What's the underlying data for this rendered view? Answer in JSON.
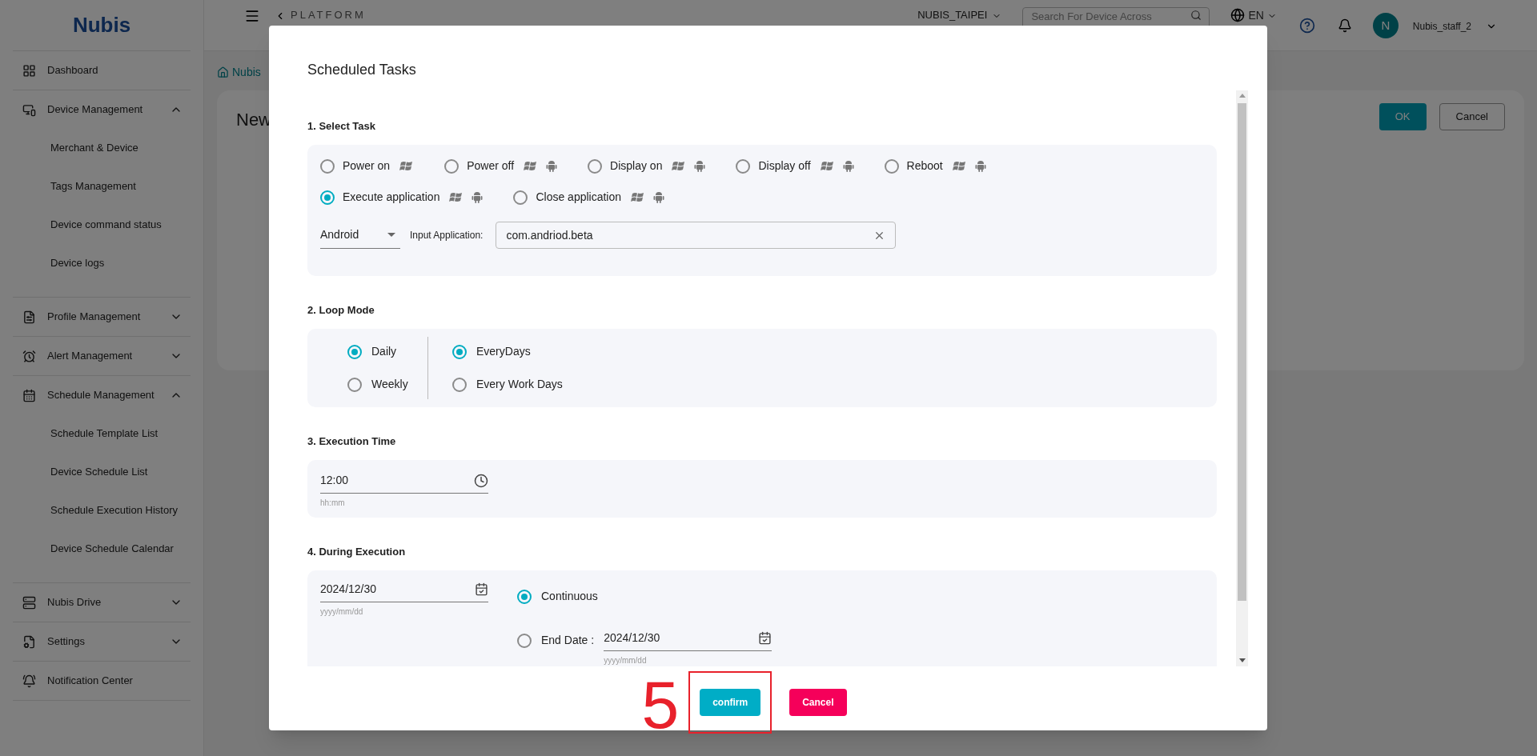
{
  "logo": "Nubis",
  "topbar": {
    "back_label": "PLATFORM",
    "store": "NUBIS_TAIPEI",
    "search": {
      "placeholder": "Search For Device Across"
    },
    "language": "EN",
    "avatar": "N",
    "user": "Nubis_staff_2"
  },
  "sidebar": {
    "items": [
      {
        "label": "Dashboard"
      },
      {
        "label": "Device Management",
        "expanded": true,
        "children": [
          {
            "label": "Merchant & Device"
          },
          {
            "label": "Tags Management"
          },
          {
            "label": "Device command status"
          },
          {
            "label": "Device logs"
          }
        ]
      },
      {
        "label": "Profile Management",
        "expanded": false
      },
      {
        "label": "Alert Management",
        "expanded": false
      },
      {
        "label": "Schedule Management",
        "expanded": true,
        "children": [
          {
            "label": "Schedule Template List"
          },
          {
            "label": "Device Schedule List"
          },
          {
            "label": "Schedule Execution History"
          },
          {
            "label": "Device Schedule Calendar"
          }
        ]
      },
      {
        "label": "Nubis Drive",
        "expanded": false
      },
      {
        "label": "Settings",
        "expanded": false
      },
      {
        "label": "Notification Center"
      }
    ]
  },
  "page": {
    "breadcrumb": "Nubis",
    "heading": "New",
    "buttons": [
      {
        "label": "OK",
        "kind": "primary"
      },
      {
        "label": "Cancel",
        "kind": "outline"
      }
    ]
  },
  "dialog": {
    "title": "Scheduled Tasks",
    "task": {
      "heading": "1. Select Task",
      "options": [
        {
          "label": "Power on",
          "selected": false,
          "windows": true,
          "android": false
        },
        {
          "label": "Power off",
          "selected": false,
          "windows": true,
          "android": true
        },
        {
          "label": "Display on",
          "selected": false,
          "windows": true,
          "android": true
        },
        {
          "label": "Display off",
          "selected": false,
          "windows": true,
          "android": true
        },
        {
          "label": "Reboot",
          "selected": false,
          "windows": true,
          "android": true
        },
        {
          "label": "Execute application",
          "selected": true,
          "windows": true,
          "android": true
        },
        {
          "label": "Close application",
          "selected": false,
          "windows": true,
          "android": true
        }
      ],
      "platform": "Android",
      "app_label": "Input Application:",
      "app_value": "com.andriod.beta"
    },
    "loop": {
      "heading": "2. Loop Mode",
      "modes": [
        {
          "label": "Daily",
          "selected": true
        },
        {
          "label": "Weekly",
          "selected": false
        }
      ],
      "days": [
        {
          "label": "EveryDays",
          "selected": true
        },
        {
          "label": "Every Work Days",
          "selected": false
        }
      ]
    },
    "time": {
      "heading": "3. Execution Time",
      "value": "12:00",
      "helper": "hh:mm"
    },
    "during": {
      "heading": "4. During Execution",
      "start": "2024/12/30",
      "start_helper": "yyyy/mm/dd",
      "options": [
        {
          "kind": "plain",
          "label": "Continuous",
          "selected": true
        },
        {
          "kind": "date",
          "label": "End Date :",
          "selected": false,
          "value": "2024/12/30",
          "helper": "yyyy/mm/dd"
        }
      ]
    },
    "annotation": "5",
    "buttons": [
      {
        "label": "confirm",
        "kind": "confirm"
      },
      {
        "label": "Cancel",
        "kind": "cancel"
      }
    ]
  }
}
